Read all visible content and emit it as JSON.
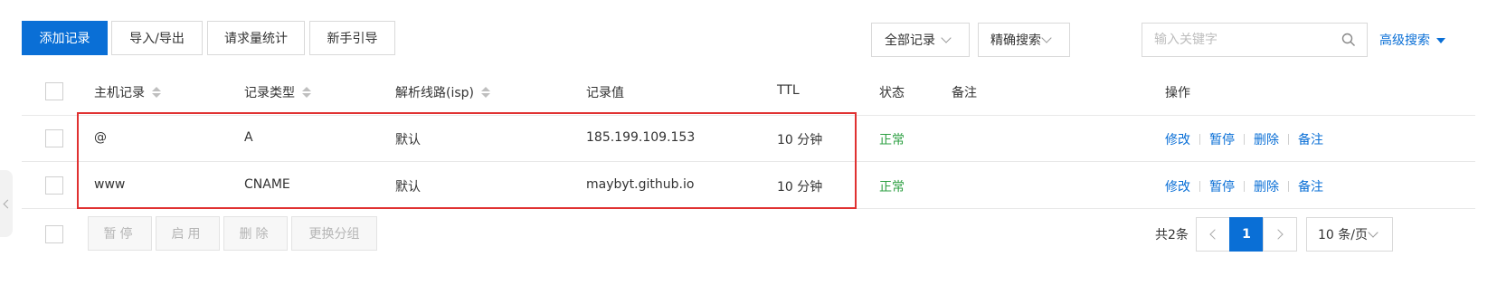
{
  "toolbar": {
    "add_record": "添加记录",
    "import_export": "导入/导出",
    "request_stats": "请求量统计",
    "beginner_guide": "新手引导",
    "filter_all_records": "全部记录",
    "exact_search": "精确搜索",
    "search_placeholder": "输入关键字",
    "advanced_search": "高级搜索"
  },
  "table": {
    "headers": {
      "host": "主机记录",
      "type": "记录类型",
      "line": "解析线路(isp)",
      "value": "记录值",
      "ttl": "TTL",
      "status": "状态",
      "remark": "备注",
      "actions": "操作"
    },
    "rows": [
      {
        "host": "@",
        "type": "A",
        "line": "默认",
        "value": "185.199.109.153",
        "ttl": "10 分钟",
        "status": "正常",
        "remark": "",
        "actions": {
          "edit": "修改",
          "pause": "暂停",
          "delete": "删除",
          "note": "备注"
        }
      },
      {
        "host": "www",
        "type": "CNAME",
        "line": "默认",
        "value": "maybyt.github.io",
        "ttl": "10 分钟",
        "status": "正常",
        "remark": "",
        "actions": {
          "edit": "修改",
          "pause": "暂停",
          "delete": "删除",
          "note": "备注"
        }
      }
    ]
  },
  "bulk": {
    "pause": "暂停",
    "enable": "启用",
    "delete": "删除",
    "change_group": "更换分组"
  },
  "pagination": {
    "total": "共2条",
    "current_page": "1",
    "page_size": "10 条/页"
  },
  "colors": {
    "primary": "#0a6fd6",
    "status_ok": "#2ea043",
    "highlight_border": "#e03131"
  }
}
